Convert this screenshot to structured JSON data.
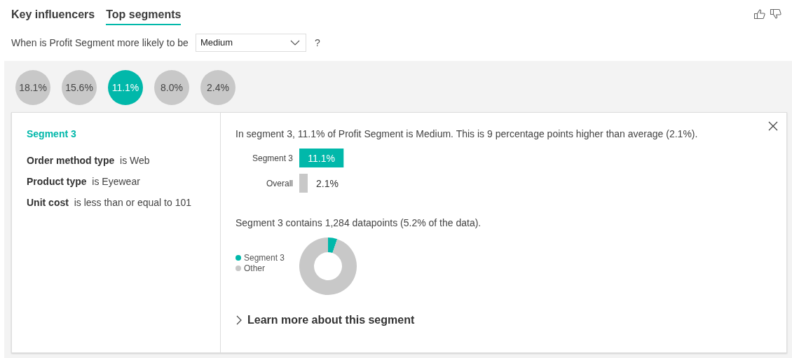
{
  "tabs": [
    {
      "label": "Key influencers",
      "selected": false
    },
    {
      "label": "Top segments",
      "selected": true
    }
  ],
  "question": {
    "label": "When is Profit Segment more likely to be",
    "dropdown": {
      "value": "Medium"
    },
    "help": "?"
  },
  "segments": [
    {
      "label": "18.1%",
      "selected": false
    },
    {
      "label": "15.6%",
      "selected": false
    },
    {
      "label": "11.1%",
      "selected": true
    },
    {
      "label": "8.0%",
      "selected": false
    },
    {
      "label": "2.4%",
      "selected": false
    }
  ],
  "detail": {
    "title": "Segment 3",
    "conditions": [
      {
        "field": "Order method type",
        "text": "is Web"
      },
      {
        "field": "Product type",
        "text": "is Eyewear"
      },
      {
        "field": "Unit cost",
        "text": "is less than or equal to 101"
      }
    ],
    "summary": "In segment 3, 11.1% of Profit Segment is Medium. This is 9 percentage points higher than average (2.1%).",
    "comparison": {
      "chart_data": {
        "type": "bar",
        "orientation": "horizontal",
        "categories": [
          "Segment 3",
          "Overall"
        ],
        "values": [
          11.1,
          2.1
        ],
        "colors": [
          "#01b8aa",
          "#c8c8c8"
        ],
        "data_labels": true,
        "value_labels": [
          "11.1%",
          "2.1%"
        ]
      }
    },
    "datapoints_text": "Segment 3 contains 1,284 datapoints (5.2% of the data).",
    "share": {
      "chart_data": {
        "type": "donut",
        "categories": [
          "Segment 3",
          "Other"
        ],
        "values": [
          5.2,
          94.8
        ],
        "colors": [
          "#01b8aa",
          "#c8c8c8"
        ],
        "legend": "left"
      }
    },
    "learn_more": "Learn more about this segment"
  }
}
